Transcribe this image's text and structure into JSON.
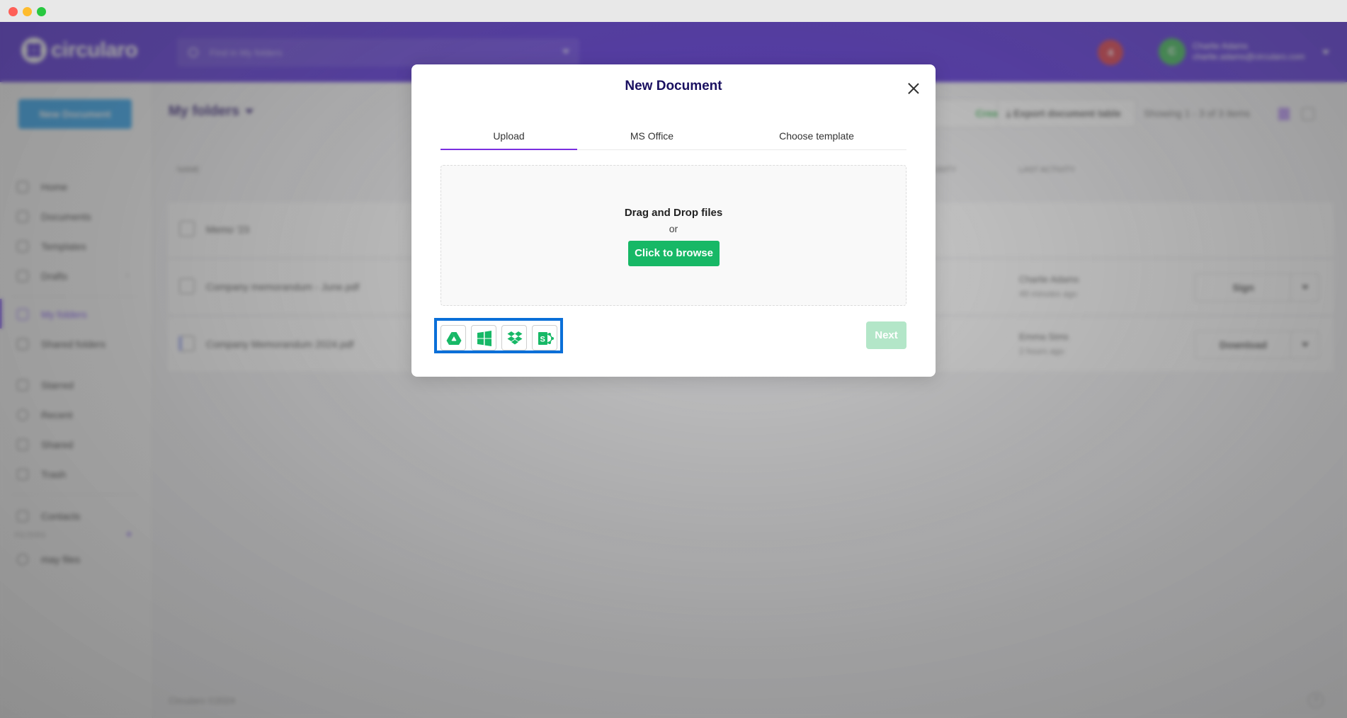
{
  "window": {
    "controls": [
      "close",
      "minimize",
      "maximize"
    ]
  },
  "header": {
    "logo_text": "circularo",
    "search_placeholder": "Find in My folders",
    "notification_count": "4",
    "user": {
      "initial": "C",
      "name": "Charlie Adams",
      "email": "charlie.adams@circularo.com"
    }
  },
  "sidebar": {
    "new_document_label": "New Document",
    "items": [
      {
        "label": "Home",
        "icon": "home-icon"
      },
      {
        "label": "Documents",
        "icon": "document-icon"
      },
      {
        "label": "Templates",
        "icon": "template-icon"
      },
      {
        "label": "Drafts",
        "icon": "drafts-icon"
      },
      {
        "label": "My folders",
        "icon": "folder-icon",
        "active": true
      },
      {
        "label": "Shared folders",
        "icon": "shared-folder-icon"
      },
      {
        "label": "Starred",
        "icon": "star-icon"
      },
      {
        "label": "Recent",
        "icon": "clock-icon"
      },
      {
        "label": "Shared",
        "icon": "share-icon"
      },
      {
        "label": "Trash",
        "icon": "trash-icon"
      },
      {
        "label": "Contacts",
        "icon": "contacts-icon"
      }
    ],
    "filters_label": "FILTERS",
    "filters_add": "+",
    "filters": [
      {
        "label": "may files",
        "icon": "search-icon"
      }
    ],
    "drafts_chevron": "›"
  },
  "main": {
    "title": "My folders",
    "create_folder_label": "Create folder",
    "export_label": "Export document table",
    "showing_text": "Showing 1 - 3 of 3 items",
    "columns": {
      "name": "NAME",
      "validity": "VALIDITY",
      "last_activity": "LAST ACTIVITY"
    },
    "rows": [
      {
        "type": "folder",
        "name": "Memo '23",
        "user": "",
        "time": "",
        "action": ""
      },
      {
        "type": "document",
        "name": "Company memorandum - June.pdf",
        "user": "Charlie Adams",
        "time": "49 minutes ago",
        "action": "Sign"
      },
      {
        "type": "document",
        "name": "Company Memorandum 2024.pdf",
        "user": "Emma Sims",
        "time": "2 hours ago",
        "action": "Download"
      }
    ],
    "footer": "Circularo ©2024",
    "help": "?"
  },
  "modal": {
    "title": "New Document",
    "tabs": [
      {
        "label": "Upload",
        "active": true
      },
      {
        "label": "MS Office"
      },
      {
        "label": "Choose template"
      }
    ],
    "dropzone": {
      "title": "Drag and Drop files",
      "or": "or",
      "browse_label": "Click to browse"
    },
    "cloud_sources": [
      {
        "name": "Google Drive",
        "icon": "google-drive-icon"
      },
      {
        "name": "OneDrive / Windows",
        "icon": "windows-icon"
      },
      {
        "name": "Dropbox",
        "icon": "dropbox-icon"
      },
      {
        "name": "SharePoint",
        "icon": "sharepoint-icon"
      }
    ],
    "next_label": "Next",
    "colors": {
      "accent": "#7a2ee0",
      "primary_green": "#17b866",
      "disabled_green": "#b3e6c8",
      "highlight": "#0a6fd8"
    }
  }
}
